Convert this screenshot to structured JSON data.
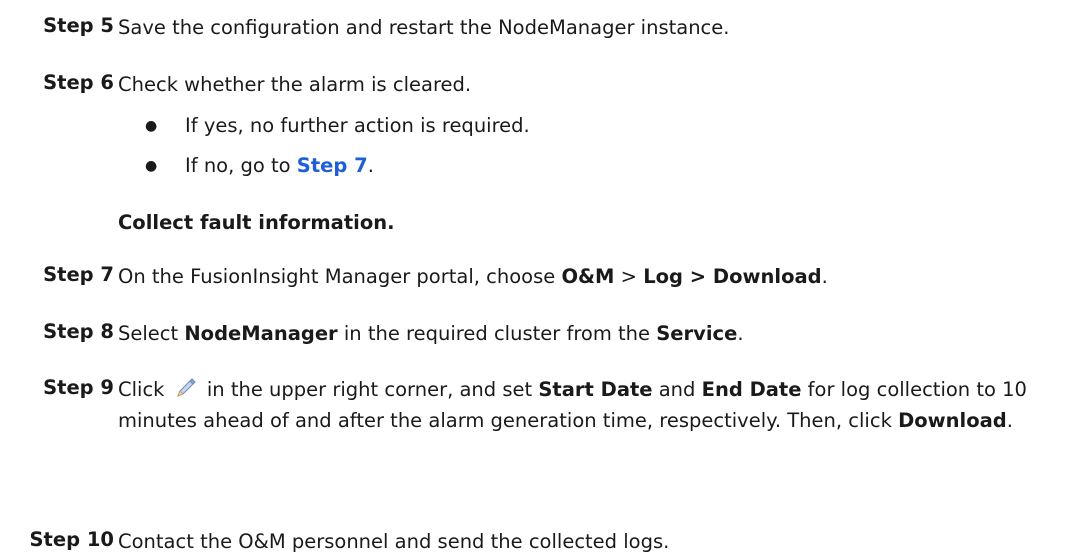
{
  "steps": {
    "s5": {
      "num": "Step 5",
      "text": "Save the configuration and restart the NodeManager instance."
    },
    "s6": {
      "num": "Step 6",
      "text": "Check whether the alarm is cleared.",
      "bullet1": "If yes, no further action is required.",
      "bullet2_pre": "If no, go to ",
      "bullet2_link": "Step 7",
      "bullet2_post": "."
    },
    "heading": "Collect fault information.",
    "s7": {
      "num": "Step 7",
      "pre": "On the FusionInsight Manager portal, choose ",
      "b1": "O&M",
      "mid": " > ",
      "b2": "Log > Download",
      "post": "."
    },
    "s8": {
      "num": "Step 8",
      "pre": "Select ",
      "b1": "NodeManager",
      "mid": " in the required cluster from the ",
      "b2": "Service",
      "post": "."
    },
    "s9": {
      "num": "Step 9",
      "pre": "Click ",
      "icon": "pencil-icon",
      "t1": " in the upper right corner, and set ",
      "b1": "Start Date",
      "t2": " and ",
      "b2": "End Date",
      "t3": " for log collection to 10 minutes ahead of and after the alarm generation time, respectively. Then, click ",
      "b3": "Download",
      "t4": "."
    },
    "s10": {
      "num": "Step 10",
      "text": "Contact the O&M personnel and send the collected logs."
    }
  },
  "colors": {
    "link": "#1e5fd6",
    "text": "#1a1a1a"
  }
}
